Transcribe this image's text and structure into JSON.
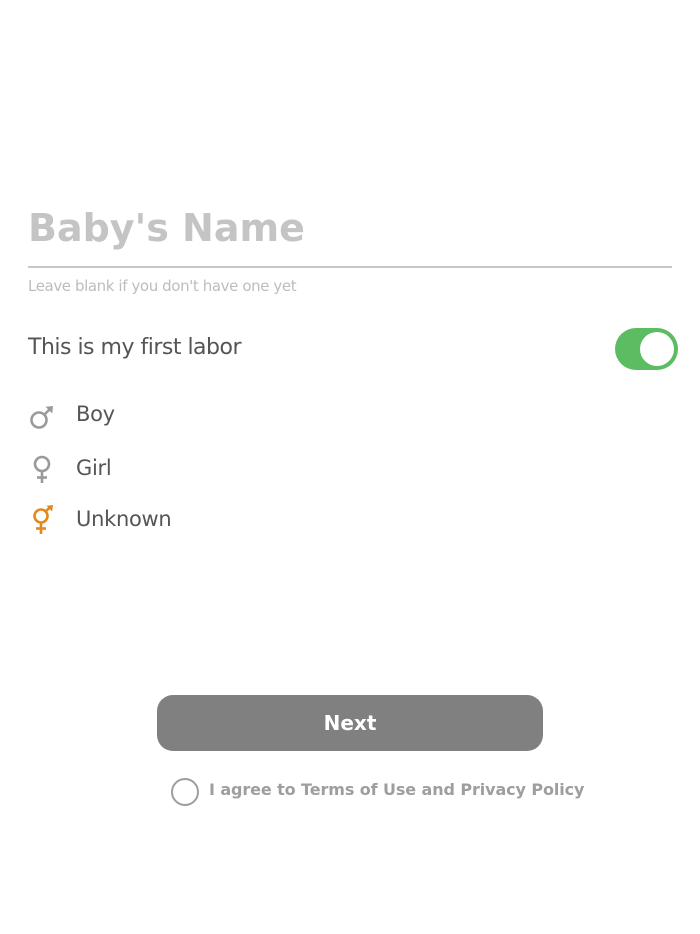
{
  "form": {
    "name_placeholder": "Baby's Name",
    "name_value": "",
    "name_hint": "Leave blank if you don't have one yet",
    "first_labor_label": "This is my first labor",
    "first_labor_enabled": true
  },
  "gender_options": [
    {
      "label": "Boy",
      "icon": "male-icon",
      "selected": false
    },
    {
      "label": "Girl",
      "icon": "female-icon",
      "selected": false
    },
    {
      "label": "Unknown",
      "icon": "unknown-gender-icon",
      "selected": true
    }
  ],
  "actions": {
    "next_label": "Next",
    "agree_label": "I agree to Terms of Use and Privacy Policy",
    "agree_checked": false
  },
  "colors": {
    "accent_green": "#5cbc61",
    "selected_orange": "#e08a1e",
    "icon_gray": "#9a9a9a",
    "button_gray": "#808080"
  }
}
